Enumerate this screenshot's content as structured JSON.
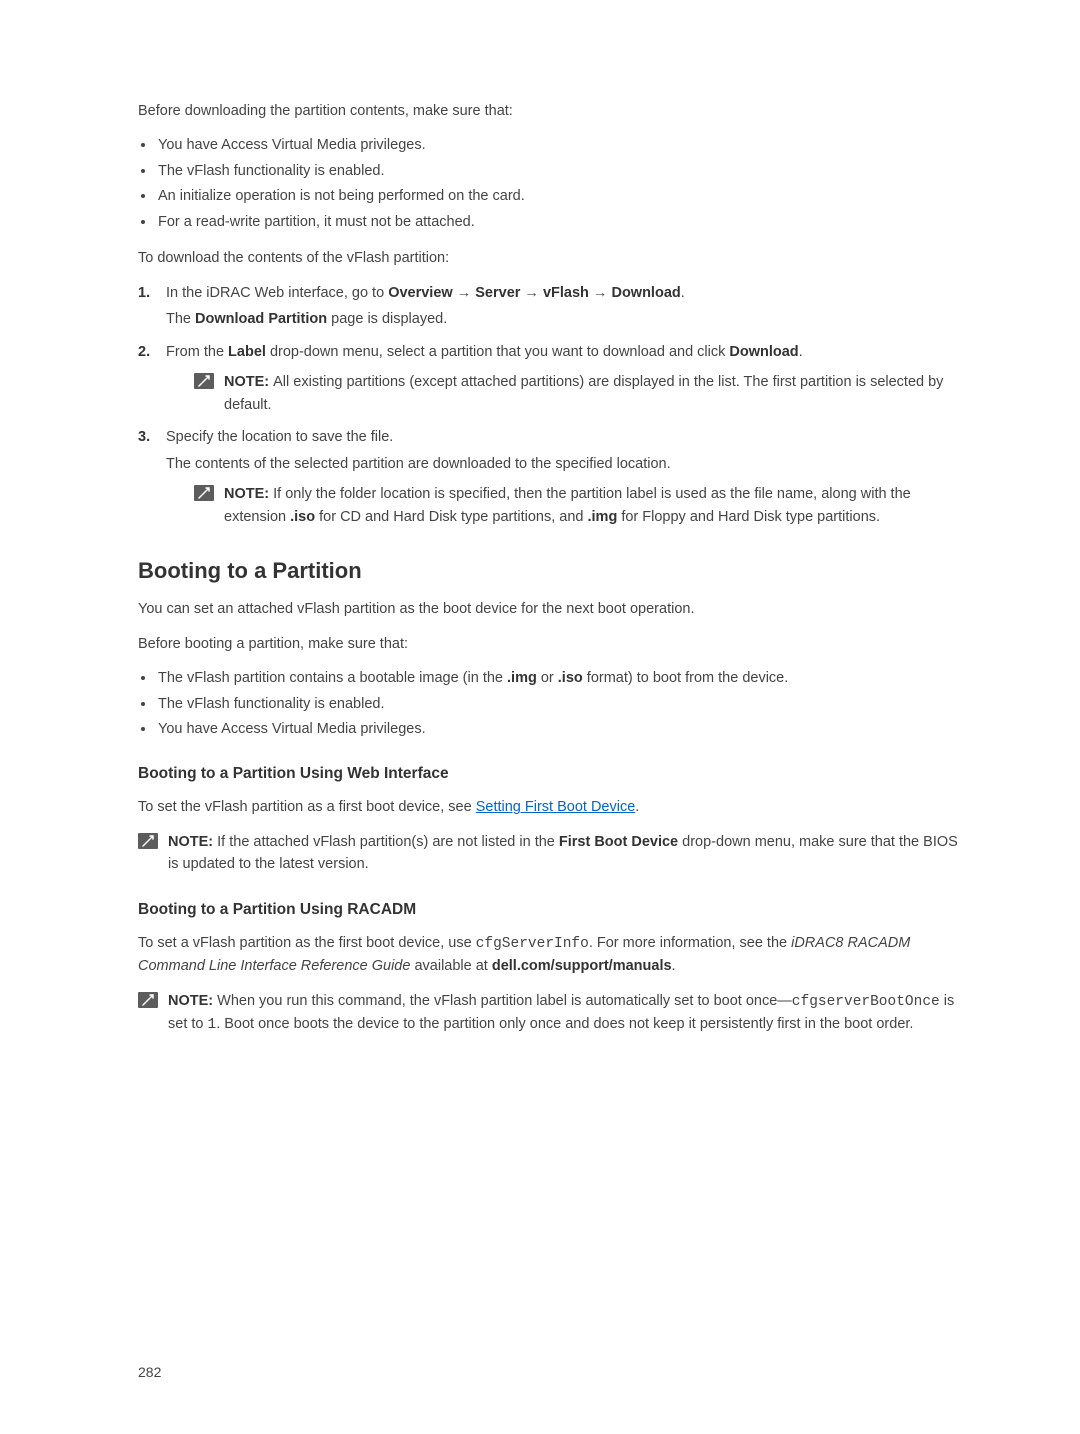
{
  "intro": {
    "p1": "Before downloading the partition contents, make sure that:",
    "bullets": [
      "You have Access Virtual Media privileges.",
      "The vFlash functionality is enabled.",
      "An initialize operation is not being performed on the card.",
      "For a read-write partition, it must not be attached."
    ],
    "p2": "To download the contents of the vFlash partition:"
  },
  "steps": {
    "s1": {
      "num": "1.",
      "t1": "In the iDRAC Web interface, go to ",
      "b1": "Overview",
      "arrow1": " → ",
      "b2": "Server",
      "arrow2": " → ",
      "b3": "vFlash",
      "arrow3": " → ",
      "b4": "Download",
      "t2": ".",
      "sub_t1": "The ",
      "sub_b1": "Download Partition",
      "sub_t2": " page is displayed."
    },
    "s2": {
      "num": "2.",
      "t1": "From the ",
      "b1": "Label",
      "t2": " drop-down menu, select a partition that you want to download and click ",
      "b2": "Download",
      "t3": ".",
      "note_label": "NOTE: ",
      "note_text": "All existing partitions (except attached partitions) are displayed in the list. The first partition is selected by default."
    },
    "s3": {
      "num": "3.",
      "t1": "Specify the location to save the file.",
      "sub": "The contents of the selected partition are downloaded to the specified location.",
      "note_label": "NOTE: ",
      "note_t1": "If only the folder location is specified, then the partition label is used as the file name, along with the extension ",
      "note_b1": ".iso",
      "note_t2": " for CD and Hard Disk type partitions, and ",
      "note_b2": ".img",
      "note_t3": " for Floppy and Hard Disk type partitions."
    }
  },
  "boot": {
    "heading": "Booting to a Partition",
    "p1": "You can set an attached vFlash partition as the boot device for the next boot operation.",
    "p2": "Before booting a partition, make sure that:",
    "bullets": {
      "b1_t1": "The vFlash partition contains a bootable image (in the ",
      "b1_b1": ".img",
      "b1_t2": " or ",
      "b1_b2": ".iso",
      "b1_t3": " format) to boot from the device.",
      "b2": "The vFlash functionality is enabled.",
      "b3": "You have Access Virtual Media privileges."
    }
  },
  "web": {
    "heading": "Booting to a Partition Using Web Interface",
    "p_t1": "To set the vFlash partition as a first boot device, see ",
    "link": "Setting First Boot Device",
    "p_t2": ".",
    "note_label": "NOTE: ",
    "note_t1": "If the attached vFlash partition(s) are not listed in the ",
    "note_b1": "First Boot Device",
    "note_t2": " drop-down menu, make sure that the BIOS is updated to the latest version."
  },
  "racadm": {
    "heading": "Booting to a Partition Using RACADM",
    "p_t1": "To set a vFlash partition as the first boot device, use ",
    "code1": "cfgServerInfo",
    "p_t2": ". For more information, see the ",
    "em1": "iDRAC8 RACADM Command Line Interface Reference Guide",
    "p_t3": " available at ",
    "b1": "dell.com/support/manuals",
    "p_t4": ".",
    "note_label": "NOTE: ",
    "note_t1": "When you run this command, the vFlash partition label is automatically set to boot once—",
    "note_code1": "cfgserverBootOnce",
    "note_t2": " is set to ",
    "note_code2": "1",
    "note_t3": ". Boot once boots the device to the partition only once and does not keep it persistently first in the boot order."
  },
  "page_number": "282"
}
